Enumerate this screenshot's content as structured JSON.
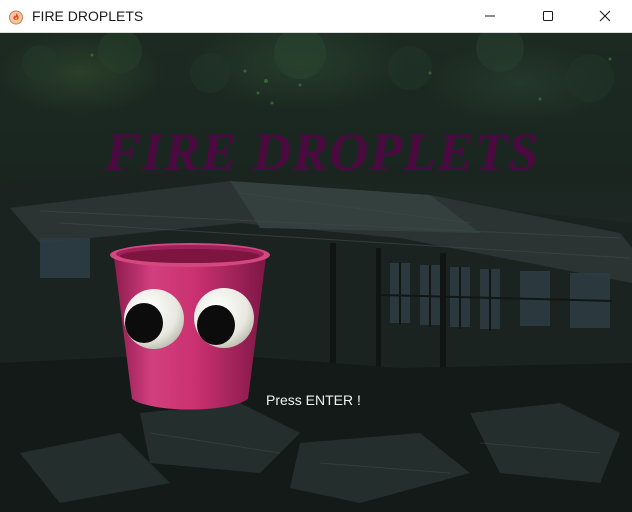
{
  "window": {
    "title": "FIRE DROPLETS",
    "icon": "fire-app-icon",
    "controls": [
      "minimize-icon",
      "maximize-icon",
      "close-icon"
    ]
  },
  "game": {
    "title": "FIRE DROPLETS",
    "prompt": "Press ENTER !",
    "character": "pink-bucket-with-googly-eyes",
    "background": "dark-abandoned-house-night",
    "colors": {
      "title": "#4a0a3f",
      "bucket": "#c0306f",
      "prompt": "#f2f2f2"
    }
  }
}
